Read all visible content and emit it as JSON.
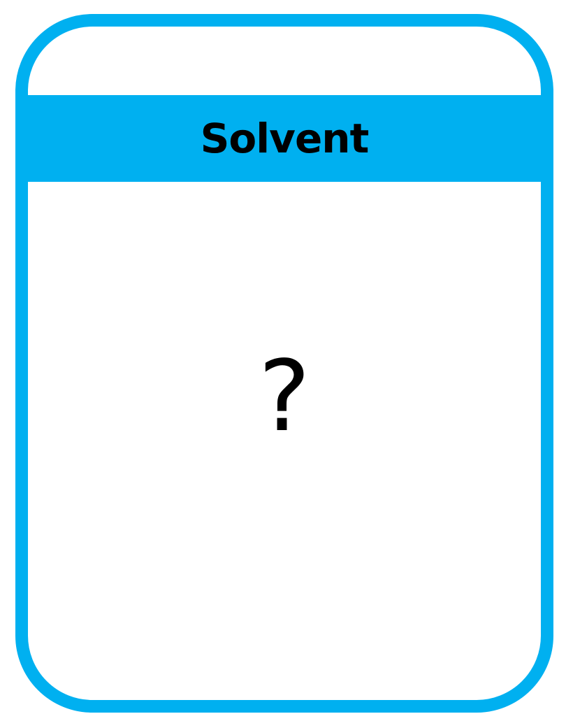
{
  "card": {
    "title": "Solvent",
    "content": "?"
  },
  "colors": {
    "accent": "#00b0f0",
    "background": "#ffffff",
    "text": "#000000"
  }
}
